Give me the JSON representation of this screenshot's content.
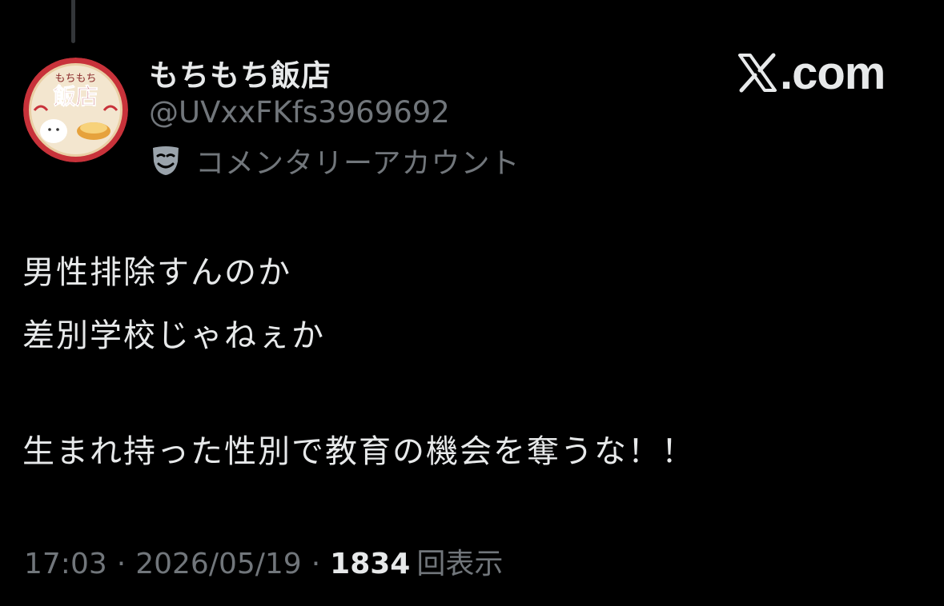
{
  "author": {
    "display_name": "もちもち飯店",
    "handle": "@UVxxFKfs3969692",
    "account_label": "コメンタリーアカウント",
    "avatar_text_top": "もちもち",
    "avatar_text_main": "飯店"
  },
  "brand": {
    "text": ".com"
  },
  "post": {
    "line1": "男性排除すんのか",
    "line2": "差別学校じゃねぇか",
    "line3": "生まれ持った性別で教育の機会を奪うな！！"
  },
  "meta": {
    "time": "17:03",
    "separator": "·",
    "date": "2026/05/19",
    "views_count": "1834",
    "views_label": "回表示"
  },
  "colors": {
    "background": "#000000",
    "primary_text": "#e7e9ea",
    "secondary_text": "#71767b",
    "avatar_red": "#c8323a",
    "avatar_cream": "#f3e6cf"
  },
  "icons": {
    "label_icon": "theater-mask-icon",
    "brand_icon": "x-logo-icon"
  }
}
